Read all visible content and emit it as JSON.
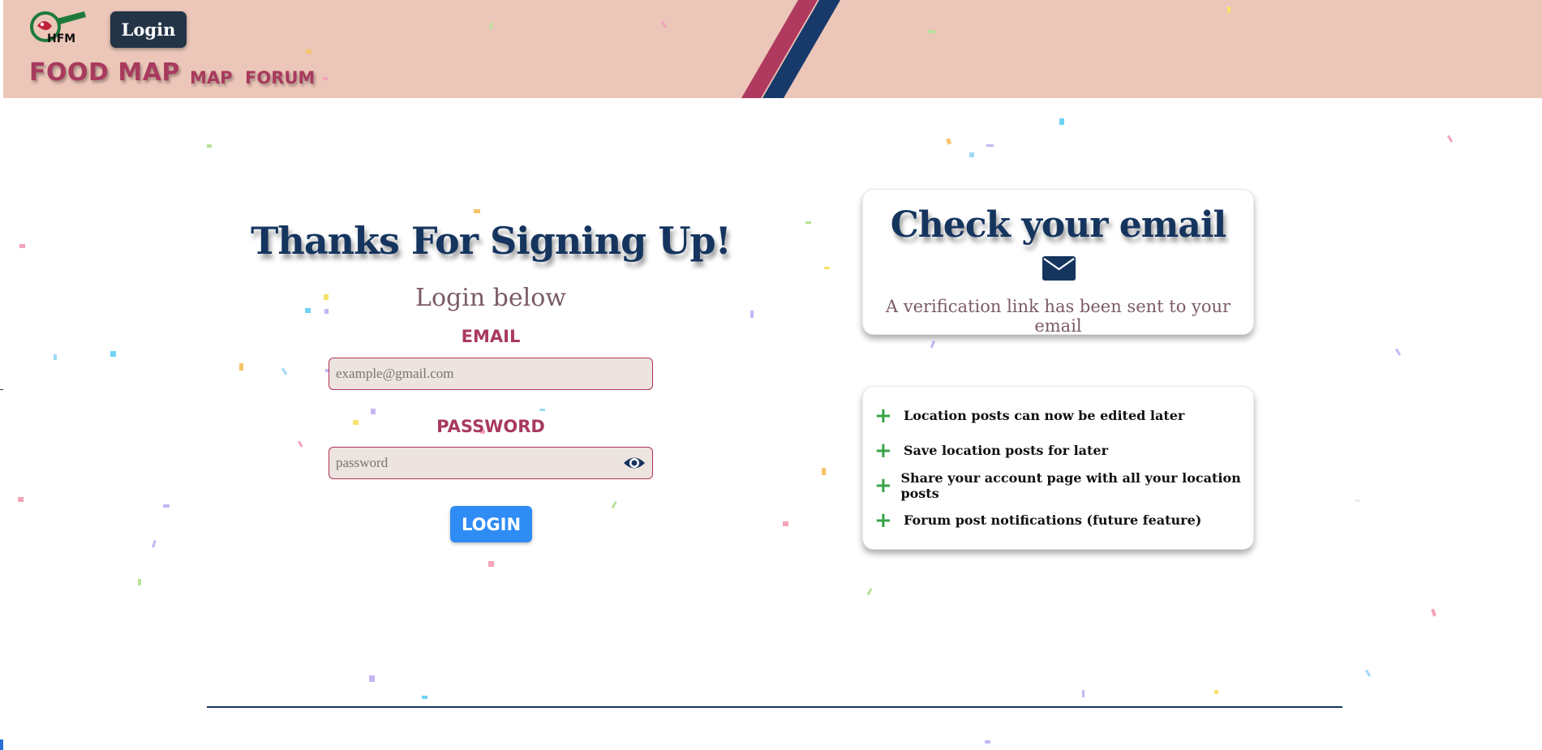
{
  "header": {
    "logo_text": "HFM",
    "login_button": "Login",
    "brand": "FOOD MAP",
    "nav": [
      {
        "label": "MAP"
      },
      {
        "label": "FORUM"
      }
    ]
  },
  "signup": {
    "title": "Thanks For Signing Up!",
    "subtitle": "Login below",
    "email_label": "EMAIL",
    "email_placeholder": "example@gmail.com",
    "password_label": "PASSWORD",
    "password_placeholder": "password",
    "login_button": "LOGIN"
  },
  "email_card": {
    "title": "Check your email",
    "icon": "envelope-icon",
    "message": "A verification link has been sent to your email"
  },
  "features": [
    {
      "icon": "plus-icon",
      "label": "Location posts can now be edited later"
    },
    {
      "icon": "plus-icon",
      "label": "Save location posts for later"
    },
    {
      "icon": "plus-icon",
      "label": "Share your account page with all your location posts"
    },
    {
      "icon": "plus-icon",
      "label": "Forum post notifications (future feature)"
    }
  ],
  "colors": {
    "header_bg": "#ecc6b8",
    "brand": "#a83a5e",
    "navy": "#15355f",
    "login_blue": "#2f8cf5",
    "plus_green": "#3aa34a"
  }
}
